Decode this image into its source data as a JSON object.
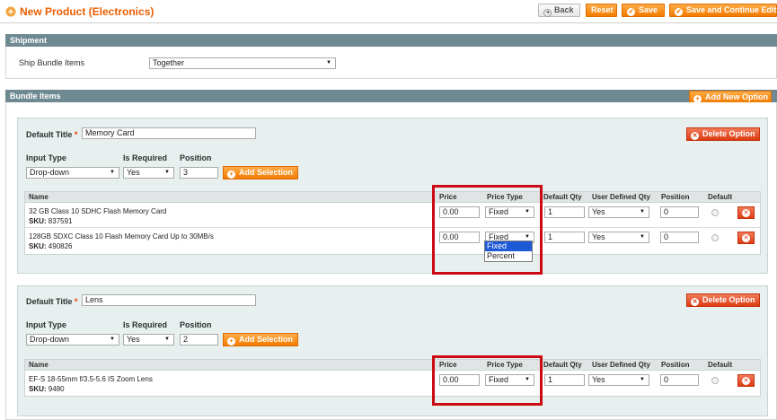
{
  "header": {
    "title": "New Product (Electronics)",
    "back": "Back",
    "reset": "Reset",
    "save": "Save",
    "save_continue": "Save and Continue Edit"
  },
  "shipment": {
    "section_title": "Shipment",
    "label": "Ship Bundle Items",
    "value": "Together"
  },
  "bundle": {
    "section_title": "Bundle Items",
    "add_option": "Add New Option",
    "labels": {
      "default_title": "Default Title",
      "required_mark": "*",
      "input_type": "Input Type",
      "is_required": "Is Required",
      "position": "Position",
      "delete_option": "Delete Option",
      "add_selection": "Add Selection"
    },
    "columns": {
      "name": "Name",
      "price": "Price",
      "price_type": "Price Type",
      "default_qty": "Default Qty",
      "user_defined_qty": "User Defined Qty",
      "position": "Position",
      "default": "Default"
    },
    "sku_label": "SKU:",
    "options": [
      {
        "title": "Memory Card",
        "input_type": "Drop-down",
        "is_required": "Yes",
        "position": "3",
        "selections": [
          {
            "name": "32 GB Class 10 SDHC Flash Memory Card",
            "sku": "837591",
            "price": "0.00",
            "price_type": "Fixed",
            "qty": "1",
            "user_qty": "Yes",
            "position": "0"
          },
          {
            "name": "128GB SDXC Class 10 Flash Memory Card Up to 30MB/s",
            "sku": "490826",
            "price": "0.00",
            "price_type": "Fixed",
            "qty": "1",
            "user_qty": "Yes",
            "position": "0"
          }
        ]
      },
      {
        "title": "Lens",
        "input_type": "Drop-down",
        "is_required": "Yes",
        "position": "2",
        "selections": [
          {
            "name": "EF-S 18-55mm f/3.5-5.6 IS Zoom Lens",
            "sku": "9480",
            "price": "0.00",
            "price_type": "Fixed",
            "qty": "1",
            "user_qty": "Yes",
            "position": "0"
          }
        ]
      }
    ],
    "price_type_options": [
      "Fixed",
      "Percent"
    ]
  },
  "colors": {
    "accent": "#f37b00",
    "title": "#eb5e00",
    "section": "#6f8992",
    "highlight": "#cc0a14",
    "delete": "#dd3c12"
  }
}
